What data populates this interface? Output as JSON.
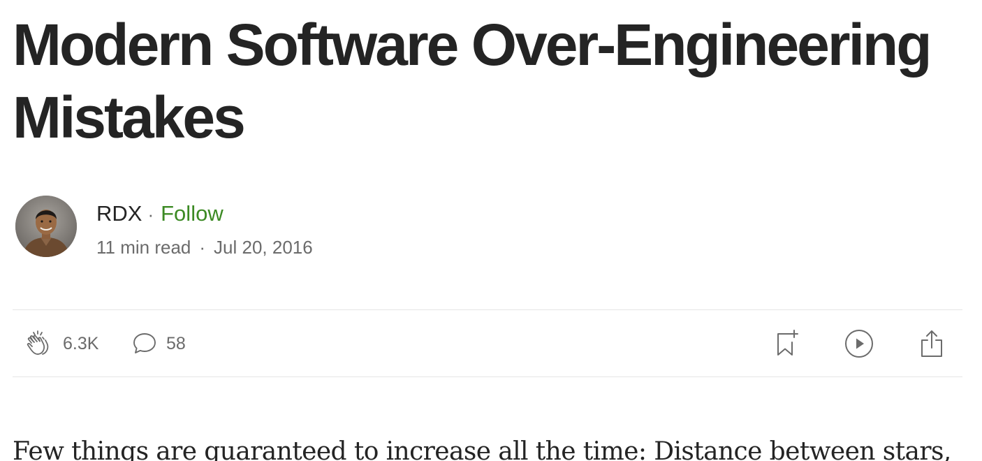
{
  "article": {
    "title": "Modern Software Over-Engineering Mistakes",
    "body_first_line": "Few things are guaranteed to increase all the time: Distance between stars,"
  },
  "author": {
    "name": "RDX",
    "separator": "·",
    "follow_label": "Follow",
    "read_time": "11 min read",
    "date": "Jul 20, 2016"
  },
  "actions": {
    "claps": "6.3K",
    "comments": "58",
    "icons": [
      "clap-icon",
      "comment-icon",
      "bookmark-add-icon",
      "play-icon",
      "share-icon"
    ]
  },
  "colors": {
    "text": "#242424",
    "muted": "#6b6b6b",
    "follow": "#3c8a24",
    "divider": "#e6e6e6"
  }
}
